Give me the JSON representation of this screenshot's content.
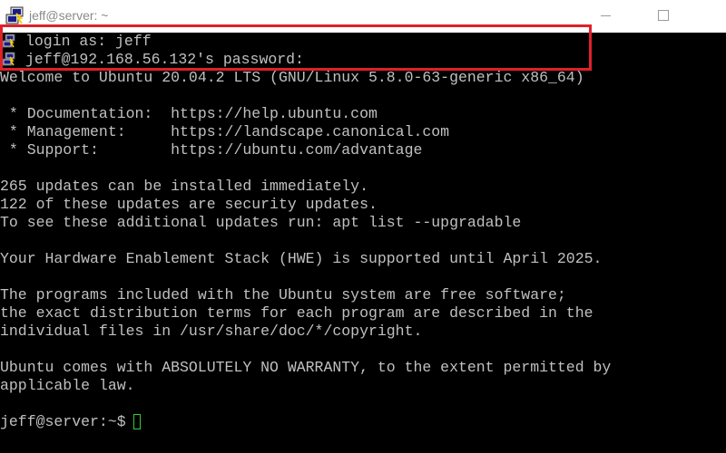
{
  "window": {
    "title": "jeff@server: ~",
    "icons": [
      "putty-icon",
      "minimize-icon",
      "maximize-icon"
    ]
  },
  "terminal": {
    "login_prompt": "login as: jeff",
    "password_prompt": "jeff@192.168.56.132's password:",
    "lines": [
      "Welcome to Ubuntu 20.04.2 LTS (GNU/Linux 5.8.0-63-generic x86_64)",
      "",
      " * Documentation:  https://help.ubuntu.com",
      " * Management:     https://landscape.canonical.com",
      " * Support:        https://ubuntu.com/advantage",
      "",
      "265 updates can be installed immediately.",
      "122 of these updates are security updates.",
      "To see these additional updates run: apt list --upgradable",
      "",
      "Your Hardware Enablement Stack (HWE) is supported until April 2025.",
      "",
      "The programs included with the Ubuntu system are free software;",
      "the exact distribution terms for each program are described in the",
      "individual files in /usr/share/doc/*/copyright.",
      "",
      "Ubuntu comes with ABSOLUTELY NO WARRANTY, to the extent permitted by",
      "applicable law.",
      ""
    ],
    "shell_prompt": "jeff@server:~$ "
  },
  "colors": {
    "terminal_background": "#000000",
    "terminal_text": "#c0c0c0",
    "highlight_border": "#e0202a",
    "cursor": "#33cc33"
  }
}
